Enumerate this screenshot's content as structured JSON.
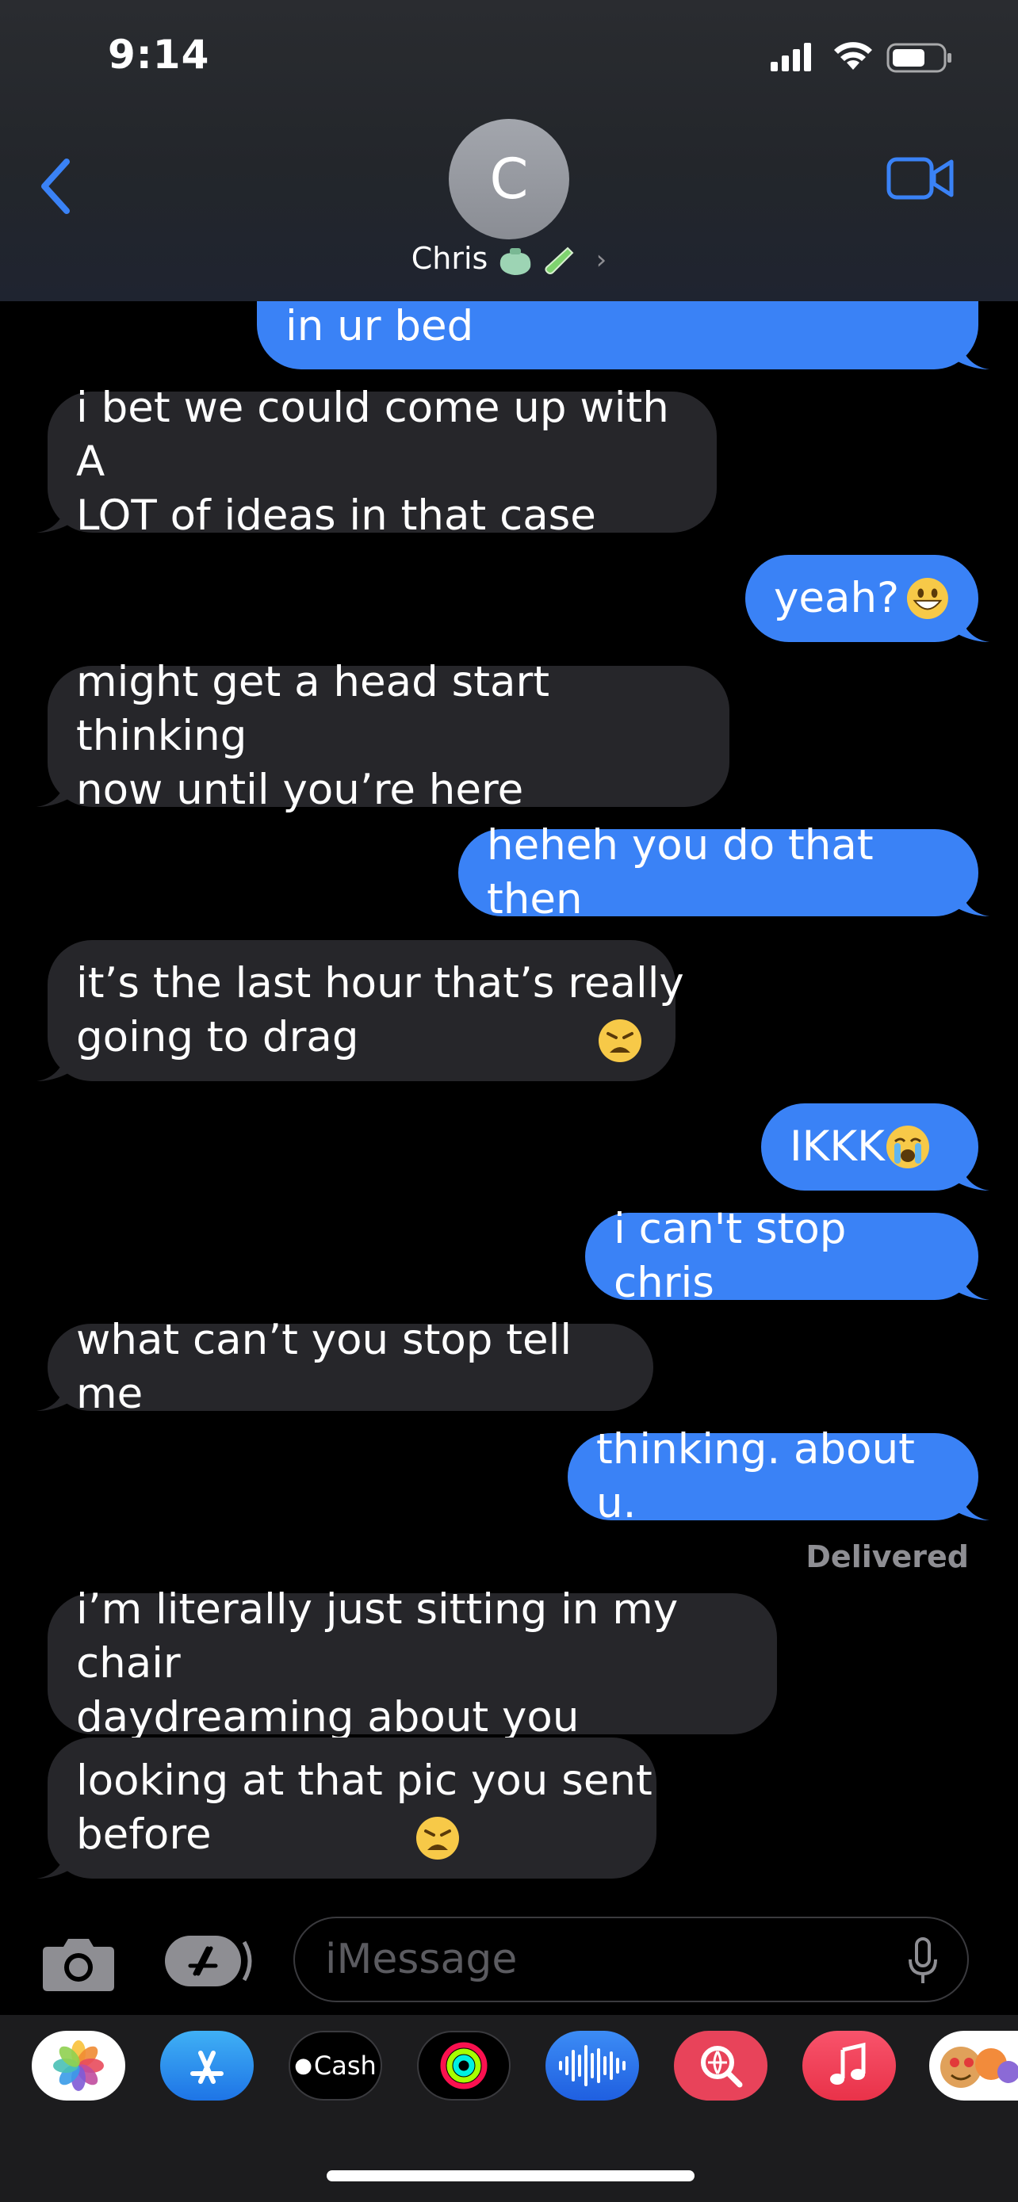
{
  "status": {
    "time": "9:14"
  },
  "header": {
    "contact_initial": "C",
    "contact_name": "Chris"
  },
  "messages": [
    {
      "side": "sent",
      "text": "in ur bed"
    },
    {
      "side": "recv",
      "text": "i bet we could come up with A\nLOT of ideas in that case"
    },
    {
      "side": "sent",
      "text": "yeah?",
      "emoji": "grinning-face"
    },
    {
      "side": "recv",
      "text": "might get a head start thinking\nnow until you’re here"
    },
    {
      "side": "sent",
      "text": "heheh you do that then"
    },
    {
      "side": "recv",
      "text": "it’s the last hour that’s really\ngoing to drag",
      "emoji": "weary-face"
    },
    {
      "side": "sent",
      "text": "IKKK",
      "emoji": "crying-face"
    },
    {
      "side": "sent",
      "text": "i can't stop chris"
    },
    {
      "side": "recv",
      "text": "what can’t you stop tell me"
    },
    {
      "side": "sent",
      "text": "thinking. about u."
    },
    {
      "side": "recv",
      "text": "i’m literally just sitting in my chair\ndaydreaming about you"
    },
    {
      "side": "recv",
      "text": "looking at that pic you sent\nbefore",
      "emoji": "weary-face"
    }
  ],
  "delivered_label": "Delivered",
  "composer": {
    "placeholder": "iMessage"
  },
  "app_drawer": {
    "apps": [
      "photos-app",
      "app-store-app",
      "apple-cash-app",
      "activity-app",
      "voice-memo-app",
      "image-search-app",
      "music-app",
      "memoji-app"
    ],
    "cash_label": "Cash"
  },
  "colors": {
    "sent_bubble": "#3a82f6",
    "received_bubble": "#26262a",
    "accent": "#3a82f6"
  }
}
